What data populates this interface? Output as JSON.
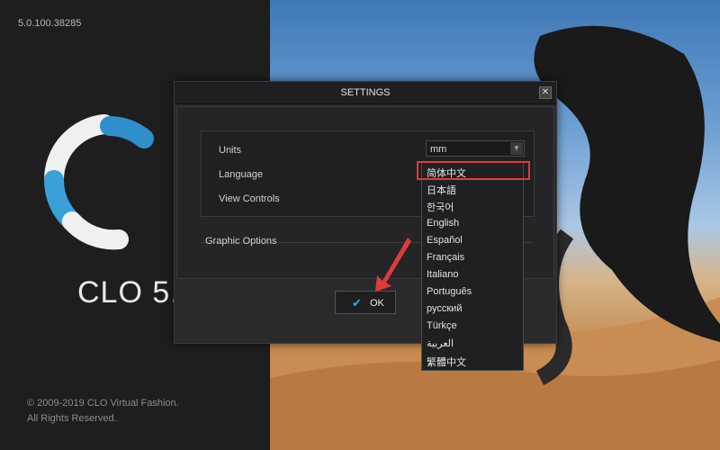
{
  "splash": {
    "version": "5.0.100.38285",
    "product_name": "CLO 5.",
    "copyright_line1": "© 2009-2019 CLO Virtual Fashion.",
    "copyright_line2": "All Rights Reserved."
  },
  "dialog": {
    "title": "SETTINGS",
    "close_glyph": "✕",
    "units_label": "Units",
    "units_value": "mm",
    "language_label": "Language",
    "view_controls_label": "View Controls",
    "graphic_options_label": "Graphic Options",
    "ok_label": "OK"
  },
  "dropdown": {
    "options": [
      "简体中文",
      "日本語",
      "한국어",
      "English",
      "Español",
      "Français",
      "Italiano",
      "Português",
      "русский",
      "Türkçe",
      "العربية",
      "繁體中文"
    ],
    "highlighted_index": 0
  },
  "colors": {
    "accent": "#3fa6e0",
    "annotation": "#e13a3a"
  },
  "icons": [
    "close-icon",
    "checkmark-icon",
    "chevron-down-icon",
    "arrow-annotation-icon"
  ]
}
